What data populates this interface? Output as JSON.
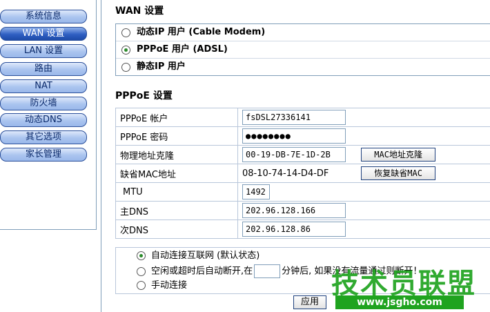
{
  "sidebar": {
    "items": [
      {
        "label": "系统信息"
      },
      {
        "label": "WAN 设置",
        "active": true
      },
      {
        "label": "LAN 设置"
      },
      {
        "label": "路由"
      },
      {
        "label": "NAT"
      },
      {
        "label": "防火墙"
      },
      {
        "label": "动态DNS"
      },
      {
        "label": "其它选项"
      },
      {
        "label": "家长管理"
      }
    ]
  },
  "wan": {
    "title": "WAN 设置",
    "modes": [
      {
        "label": "动态IP 用户 (Cable Modem)",
        "selected": false
      },
      {
        "label": "PPPoE 用户 (ADSL)",
        "selected": true
      },
      {
        "label": "静态IP 用户",
        "selected": false
      }
    ]
  },
  "pppoe": {
    "title": "PPPoE 设置",
    "account_label": "PPPoE 帐户",
    "account_value": "fsDSL27336141",
    "password_label": "PPPoE 密码",
    "password_value": "●●●●●●●●",
    "mac_clone_label": "物理地址克隆",
    "mac_clone_value": "00-19-DB-7E-1D-2B",
    "mac_clone_button": "MAC地址克隆",
    "default_mac_label": "缺省MAC地址",
    "default_mac_value": "08-10-74-14-D4-DF",
    "restore_mac_button": "恢复缺省MAC",
    "mtu_label": "MTU",
    "mtu_value": "1492",
    "dns1_label": "主DNS",
    "dns1_value": "202.96.128.166",
    "dns2_label": "次DNS",
    "dns2_value": "202.96.128.86"
  },
  "dial": {
    "auto_label": "自动连接互联网 (默认状态)",
    "idle_prefix": "空闲或超时后自动断开,在",
    "idle_suffix": "分钟后, 如果没有流量通过则断开！",
    "manual_label": "手动连接",
    "selected": "auto"
  },
  "apply_button": "应用",
  "watermark": {
    "big": "技术员联盟",
    "small": "www.jsgho.com"
  },
  "colors": {
    "accent": "#2f5fc2",
    "watermark": "#1fa31f"
  }
}
